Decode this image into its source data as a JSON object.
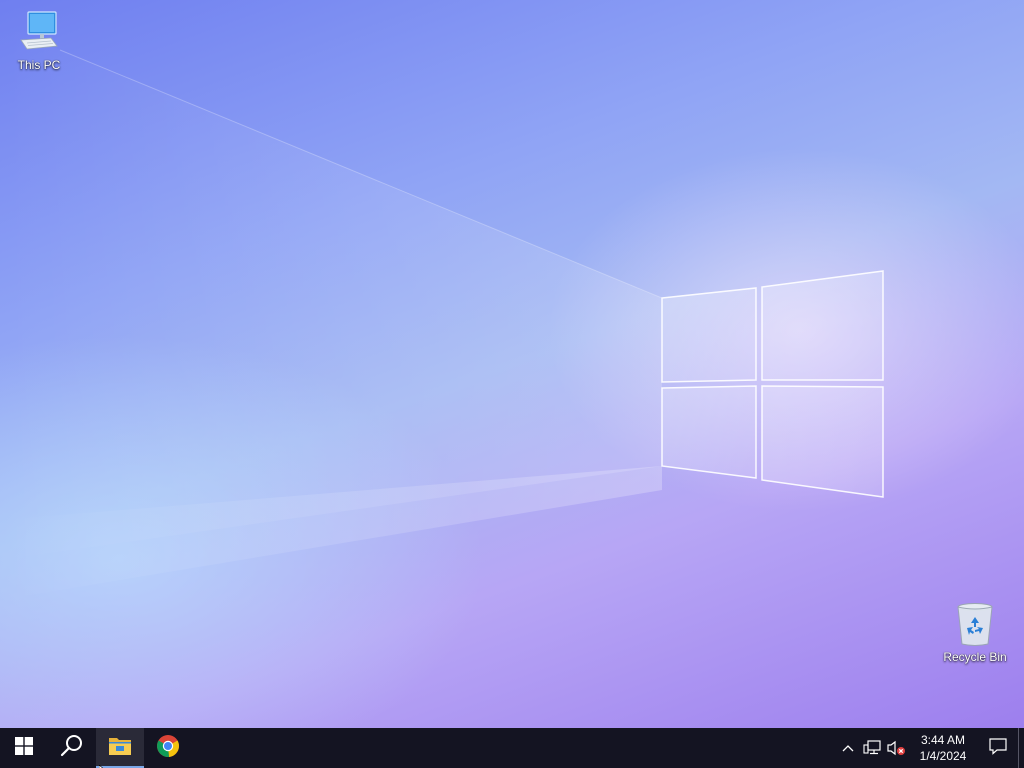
{
  "desktop": {
    "icons": [
      {
        "label": "This PC",
        "icon": "computer-icon"
      },
      {
        "label": "Recycle Bin",
        "icon": "recycle-bin-icon"
      }
    ]
  },
  "taskbar": {
    "start": {
      "icon": "windows-logo-icon"
    },
    "search": {
      "icon": "search-icon"
    },
    "pinned": [
      {
        "app": "File Explorer",
        "icon": "folder-icon",
        "active": true
      },
      {
        "app": "Google Chrome",
        "icon": "chrome-icon",
        "active": false
      }
    ],
    "tray": {
      "icons": [
        "chevron-up-icon",
        "network-icon",
        "volume-muted-icon"
      ],
      "time": "3:44 AM",
      "date": "1/4/2024",
      "notification_icon": "action-center-icon"
    }
  },
  "colors": {
    "taskbar_bg": "#141422",
    "active_indicator": "#7aa7e8",
    "wallpaper_light": "#a3b8f3",
    "wallpaper_purple": "#9d7fee"
  }
}
